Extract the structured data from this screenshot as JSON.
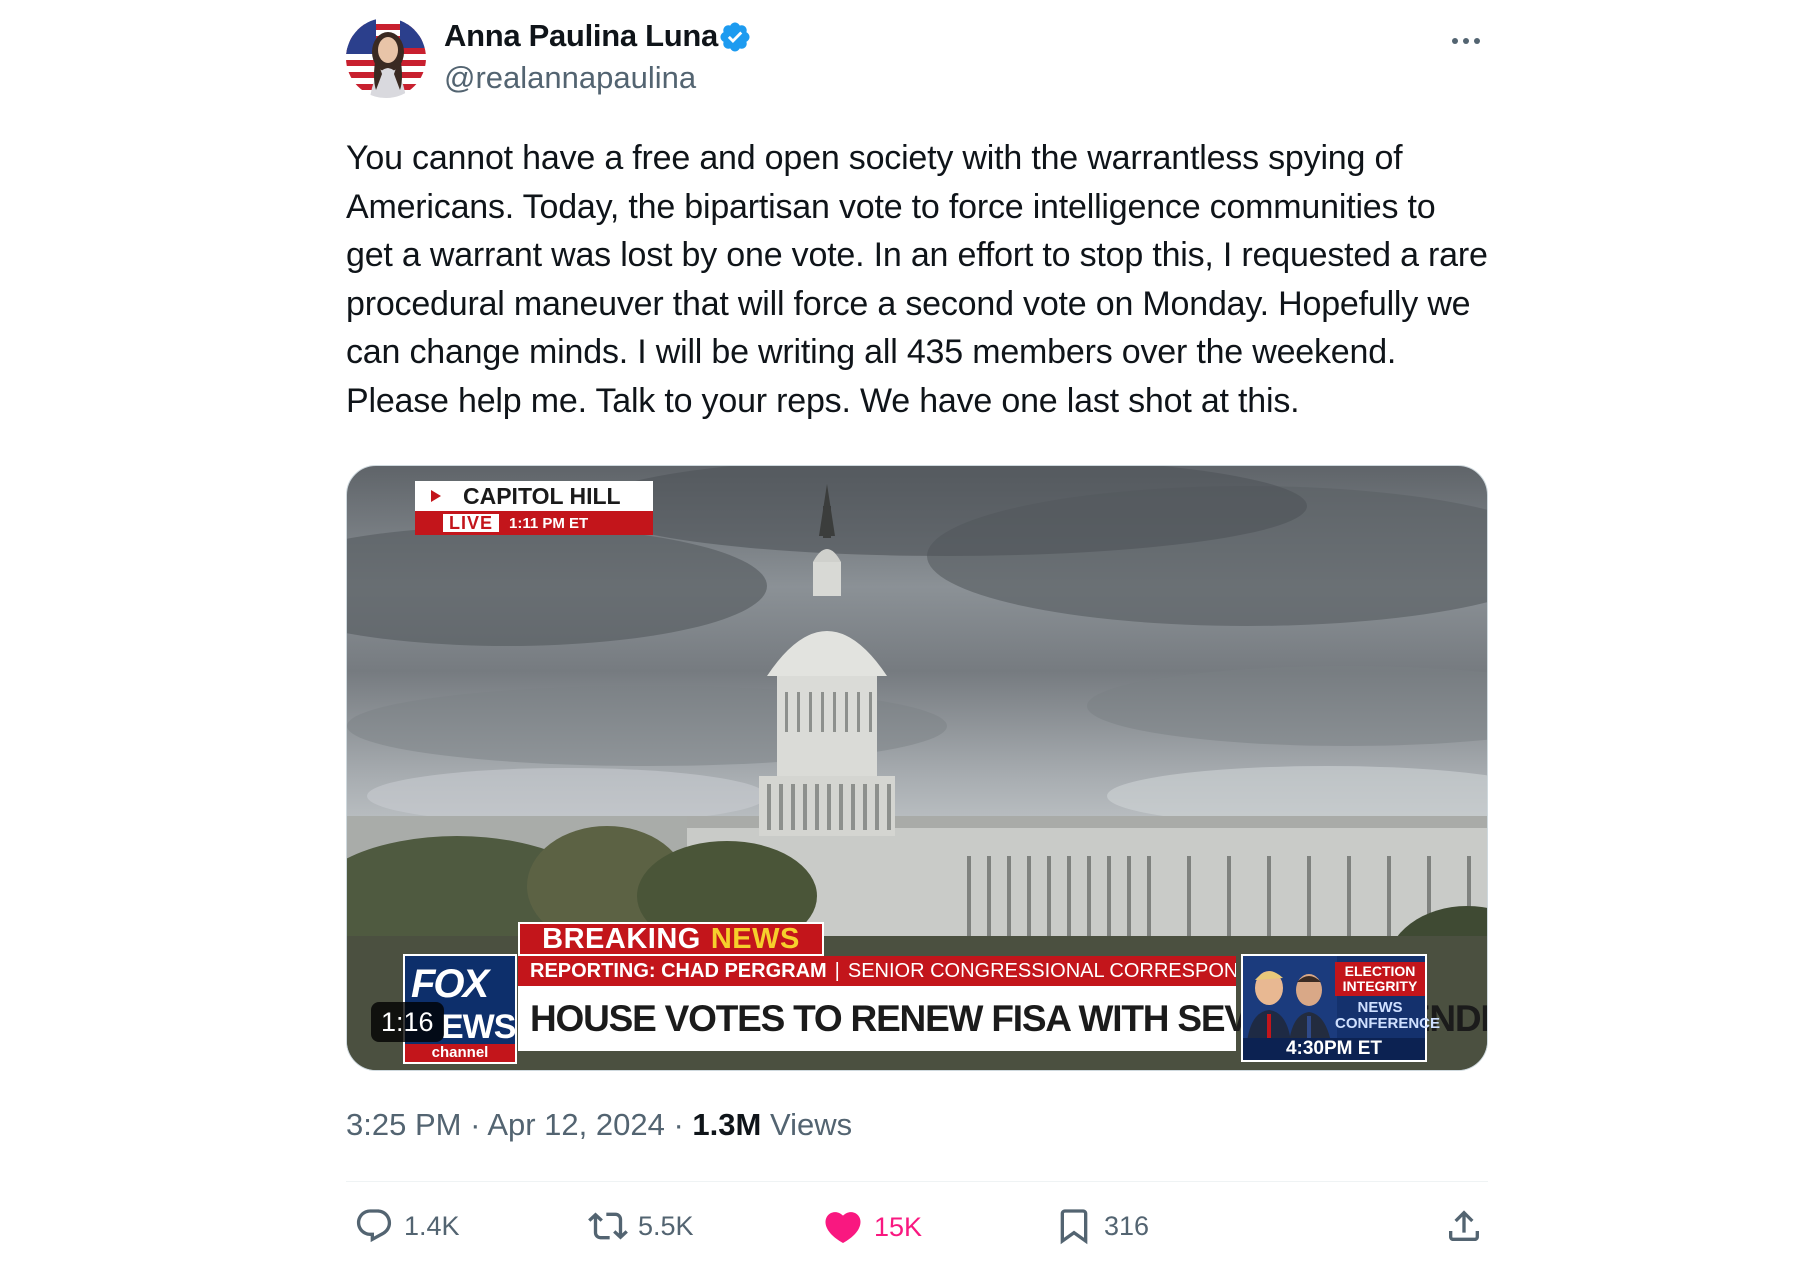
{
  "author": {
    "name": "Anna Paulina Luna",
    "handle": "@realannapaulina",
    "avatar_icon": "avatar-photo",
    "verified_icon": "verified-badge-icon",
    "verified_color": "#1d9bf0"
  },
  "more_icon": "more-options-icon",
  "tweet_text": "You cannot have a free and open society with the warrantless spying of Americans. Today, the bipartisan vote to force intelligence communities to get a warrant was lost by one vote. In an effort to stop this, I requested a rare procedural maneuver that will force a second vote on Monday. Hopefully we can change minds. I will be writing all 435 members over the weekend. Please help me. Talk to your reps. We have one last shot at this.",
  "media": {
    "duration": "1:16",
    "location_label": "CAPITOL HILL",
    "live_label": "LIVE",
    "live_time": "1:11 PM ET",
    "breaking_word1": "BREAKING",
    "breaking_word2": "NEWS",
    "reporting_label": "REPORTING: CHAD PERGRAM",
    "reporting_title": "SENIOR CONGRESSIONAL CORRESPONDENT",
    "headline": "HOUSE VOTES TO RENEW FISA WITH SEVERAL AMENDMENTS",
    "logo_top": "FOX",
    "logo_mid": "EWS",
    "logo_bottom": "channel",
    "presser_label1": "ELECTION INTEGRITY",
    "presser_label2": "NEWS CONFERENCE",
    "presser_time": "4:30PM ET"
  },
  "meta": {
    "time": "3:25 PM",
    "date": "Apr 12, 2024",
    "views_count": "1.3M",
    "views_label": "Views",
    "dot": "·"
  },
  "actions": {
    "replies": "1.4K",
    "reposts": "5.5K",
    "likes": "15K",
    "bookmarks": "316",
    "like_color": "#f91880",
    "icon_color": "#536471"
  }
}
